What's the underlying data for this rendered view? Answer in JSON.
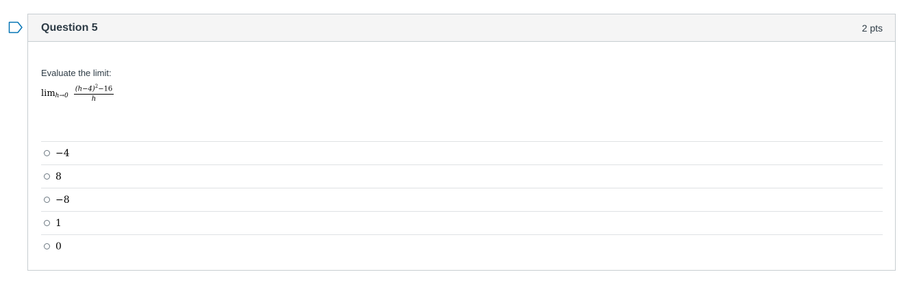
{
  "question": {
    "title": "Question 5",
    "points": "2 pts",
    "prompt": "Evaluate the limit:",
    "math": {
      "lim": "lim",
      "subscript": "h→0",
      "numerator_paren": "(h−4)",
      "numerator_exponent": "2",
      "numerator_rest": "−16",
      "denominator": "h"
    }
  },
  "answers": [
    "−4",
    "8",
    "−8",
    "1",
    "0"
  ],
  "colors": {
    "header_bg": "#f5f5f5",
    "border": "#c7cdd1",
    "flag": "#0374b5"
  }
}
